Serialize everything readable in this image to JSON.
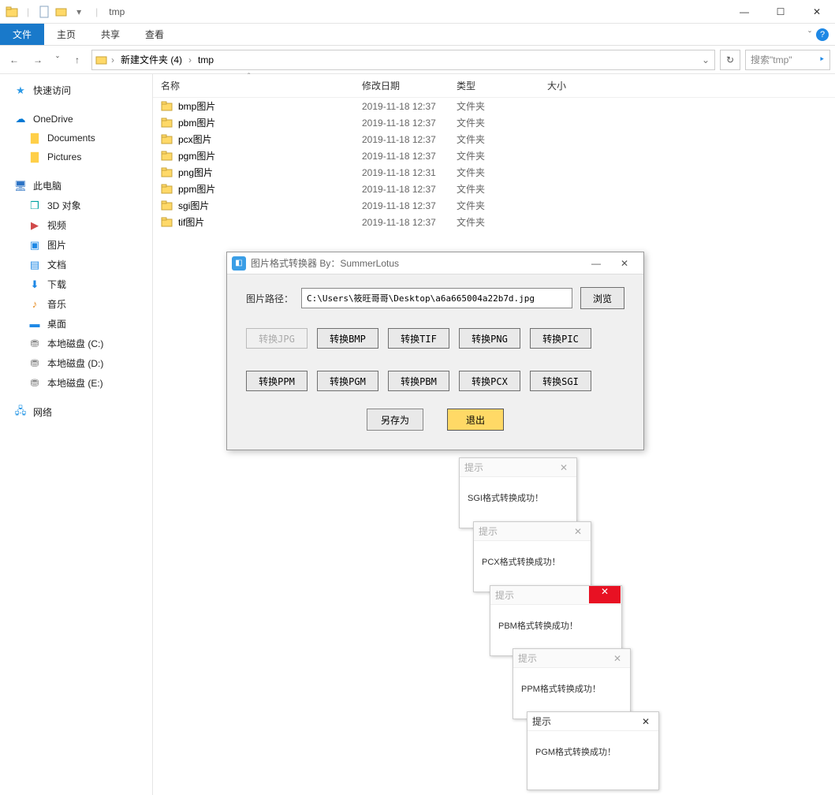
{
  "window": {
    "title": "tmp",
    "win_min": "—",
    "win_max": "☐",
    "win_close": "✕"
  },
  "ribbon": {
    "file": "文件",
    "home": "主页",
    "share": "共享",
    "view": "查看",
    "caret": "ˇ",
    "help": "?"
  },
  "nav": {
    "back": "←",
    "forward": "→",
    "recent": "ˇ",
    "up": "↑",
    "refresh": "↻",
    "search_placeholder": "搜索\"tmp\"",
    "search_icon": "⯈",
    "addr_dd": "⌄"
  },
  "breadcrumb": {
    "seg1": "新建文件夹 (4)",
    "seg2": "tmp",
    "chev": "›"
  },
  "sidebar": {
    "quick": "快速访问",
    "onedrive": "OneDrive",
    "documents": "Documents",
    "pictures": "Pictures",
    "thispc": "此电脑",
    "obj3d": "3D 对象",
    "videos": "视频",
    "images": "图片",
    "docs": "文档",
    "downloads": "下载",
    "music": "音乐",
    "desktop": "桌面",
    "drive_c": "本地磁盘 (C:)",
    "drive_d": "本地磁盘 (D:)",
    "drive_e": "本地磁盘 (E:)",
    "network": "网络"
  },
  "columns": {
    "name": "名称",
    "date": "修改日期",
    "type": "类型",
    "size": "大小",
    "sort": "ˆ"
  },
  "rows": [
    {
      "name": "bmp图片",
      "date": "2019-11-18 12:37",
      "type": "文件夹",
      "size": ""
    },
    {
      "name": "pbm图片",
      "date": "2019-11-18 12:37",
      "type": "文件夹",
      "size": ""
    },
    {
      "name": "pcx图片",
      "date": "2019-11-18 12:37",
      "type": "文件夹",
      "size": ""
    },
    {
      "name": "pgm图片",
      "date": "2019-11-18 12:37",
      "type": "文件夹",
      "size": ""
    },
    {
      "name": "png图片",
      "date": "2019-11-18 12:31",
      "type": "文件夹",
      "size": ""
    },
    {
      "name": "ppm图片",
      "date": "2019-11-18 12:37",
      "type": "文件夹",
      "size": ""
    },
    {
      "name": "sgi图片",
      "date": "2019-11-18 12:37",
      "type": "文件夹",
      "size": ""
    },
    {
      "name": "tif图片",
      "date": "2019-11-18 12:37",
      "type": "文件夹",
      "size": ""
    }
  ],
  "dialog": {
    "title": "图片格式转换器 By：SummerLotus",
    "min": "—",
    "close": "✕",
    "path_label": "图片路径：",
    "path_value": "C:\\Users\\筱旺哥哥\\Desktop\\a6a665004a22b7d.jpg",
    "browse": "浏览",
    "btn_jpg": "转换JPG",
    "btn_bmp": "转换BMP",
    "btn_tif": "转换TIF",
    "btn_png": "转换PNG",
    "btn_pic": "转换PIC",
    "btn_ppm": "转换PPM",
    "btn_pgm": "转换PGM",
    "btn_pbm": "转换PBM",
    "btn_pcx": "转换PCX",
    "btn_sgi": "转换SGI",
    "save_as": "另存为",
    "exit": "退出"
  },
  "toasts": {
    "title": "提示",
    "close": "✕",
    "msg_sgi": "SGI格式转换成功！",
    "msg_pcx": "PCX格式转换成功！",
    "msg_pbm": "PBM格式转换成功！",
    "msg_ppm": "PPM格式转换成功！",
    "msg_pgm": "PGM格式转换成功！"
  }
}
